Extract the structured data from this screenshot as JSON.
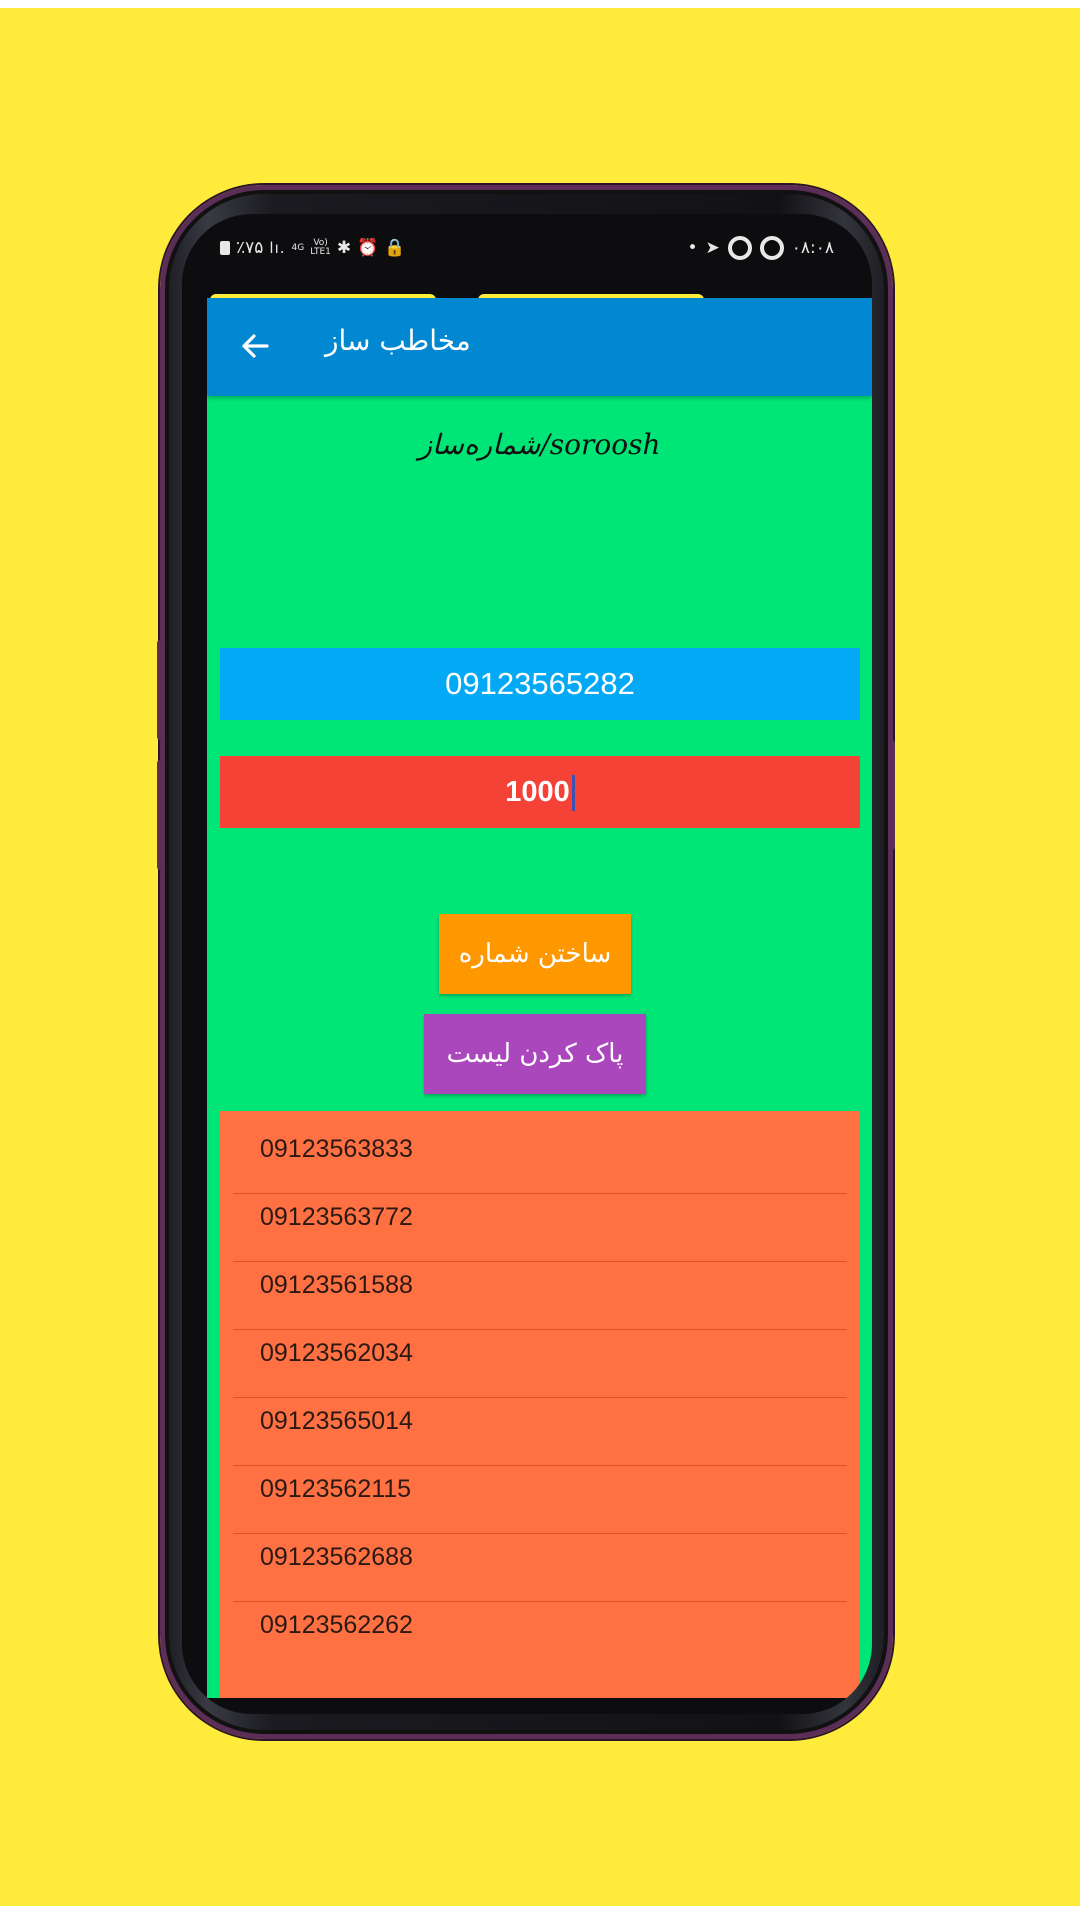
{
  "status_bar": {
    "left_text": "٪۷۵",
    "signal": "lı.",
    "net1": "4G",
    "net2": "Vo)",
    "net3": "LTE1",
    "icons": [
      "bluetooth-icon",
      "alarm-icon",
      "lock-icon"
    ],
    "right_time": "۰۸:۰۸",
    "dot": "•"
  },
  "appbar": {
    "title": "مخاطب ساز",
    "back_icon": "arrow-back-icon"
  },
  "subtitle": "شماره‌ساز/soroosh",
  "phone_input": {
    "value": "09123565282"
  },
  "count_input": {
    "value": "1000"
  },
  "buttons": {
    "generate_label": "ساختن شماره",
    "clear_label": "پاک کردن لیست"
  },
  "numbers": [
    "09123563833",
    "09123563772",
    "09123561588",
    "09123562034",
    "09123565014",
    "09123562115",
    "09123562688",
    "09123562262"
  ],
  "colors": {
    "page_background": "#ffeb3b",
    "appbar": "#0288d1",
    "app_background": "#00e676",
    "phone_input": "#03a9f4",
    "count_input": "#f44336",
    "generate_button": "#ff9800",
    "clear_button": "#ab47bc",
    "list_background": "#ff7043"
  }
}
